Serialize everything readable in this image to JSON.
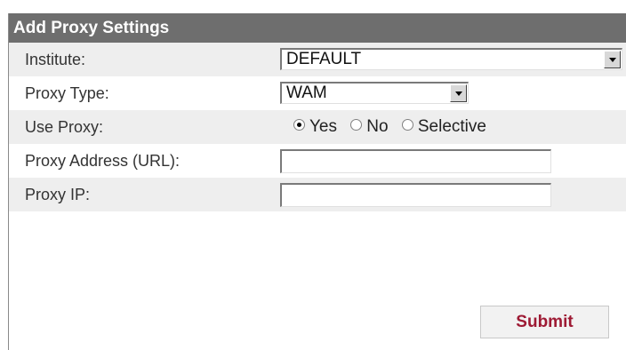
{
  "form": {
    "title": "Add Proxy Settings",
    "institute": {
      "label": "Institute:",
      "value": "DEFAULT"
    },
    "proxy_type": {
      "label": "Proxy Type:",
      "value": "WAM"
    },
    "use_proxy": {
      "label": "Use Proxy:",
      "options": [
        "Yes",
        "No",
        "Selective"
      ],
      "selected": "Yes"
    },
    "proxy_address": {
      "label": "Proxy Address (URL):",
      "value": ""
    },
    "proxy_ip": {
      "label": "Proxy IP:",
      "value": ""
    },
    "submit_label": "Submit"
  },
  "colors": {
    "header_bg": "#6e6e6e",
    "alt_row_bg": "#eeeeee",
    "submit_text": "#9e1a34"
  },
  "icons": {
    "dropdown": "chevron-down-icon"
  }
}
